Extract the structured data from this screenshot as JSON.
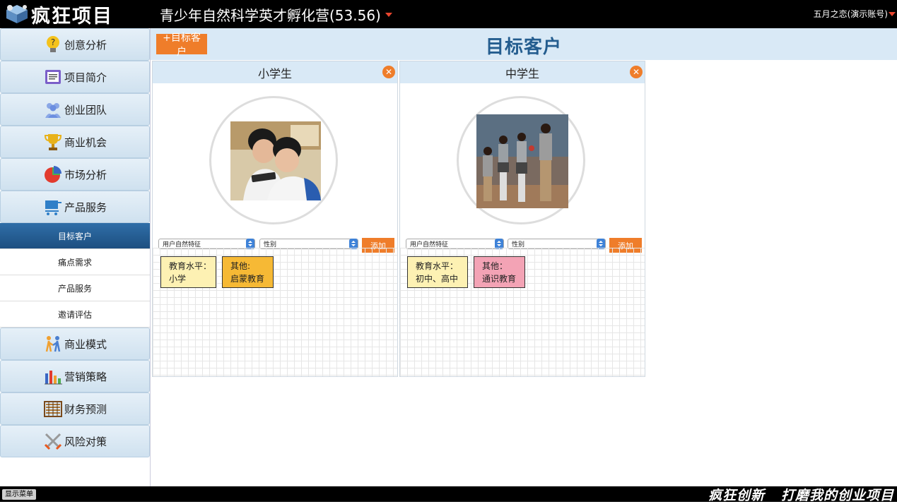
{
  "app": {
    "logo_text": "疯狂项目",
    "project_title": "青少年自然科学英才孵化营(53.56)",
    "user": "五月之恋(演示账号)"
  },
  "sidebar": {
    "top_items": [
      {
        "label": "创意分析",
        "icon": "lightbulb-question-icon"
      },
      {
        "label": "项目简介",
        "icon": "document-icon"
      },
      {
        "label": "创业团队",
        "icon": "team-icon"
      },
      {
        "label": "商业机会",
        "icon": "trophy-icon"
      },
      {
        "label": "市场分析",
        "icon": "pie-chart-icon"
      },
      {
        "label": "产品服务",
        "icon": "cart-icon"
      }
    ],
    "sub_items": [
      "目标客户",
      "痛点需求",
      "产品服务",
      "邀请评估"
    ],
    "active_sub": "目标客户",
    "bottom_items": [
      {
        "label": "商业模式",
        "icon": "people-icon"
      },
      {
        "label": "营销策略",
        "icon": "bar-chart-icon"
      },
      {
        "label": "财务预测",
        "icon": "abacus-icon"
      },
      {
        "label": "风险对策",
        "icon": "crossed-swords-icon"
      }
    ]
  },
  "header": {
    "add_button": "+目标客户",
    "title": "目标客户"
  },
  "cards": [
    {
      "title": "小学生",
      "select1": "用户自然特征",
      "select2": "性别",
      "add_label": "添加",
      "notes": [
        {
          "line1": "教育水平：",
          "line2": "小学",
          "color": "#fdf1b3"
        },
        {
          "line1": "其他:",
          "line2": "启蒙教育",
          "color": "#f6b935"
        }
      ]
    },
    {
      "title": "中学生",
      "select1": "用户自然特征",
      "select2": "性别",
      "add_label": "添加",
      "notes": [
        {
          "line1": "教育水平：",
          "line2": "初中、高中",
          "color": "#fdf1b3"
        },
        {
          "line1": "其他：",
          "line2": "通识教育",
          "color": "#f3a3b5"
        }
      ]
    }
  ],
  "footer": {
    "show_menu": "显示菜单",
    "slogan": "疯狂创新   打磨我的创业项目"
  },
  "colors": {
    "accent": "#ef7d2a",
    "nav_active": "#1d4f80",
    "title_blue": "#245d8f"
  }
}
